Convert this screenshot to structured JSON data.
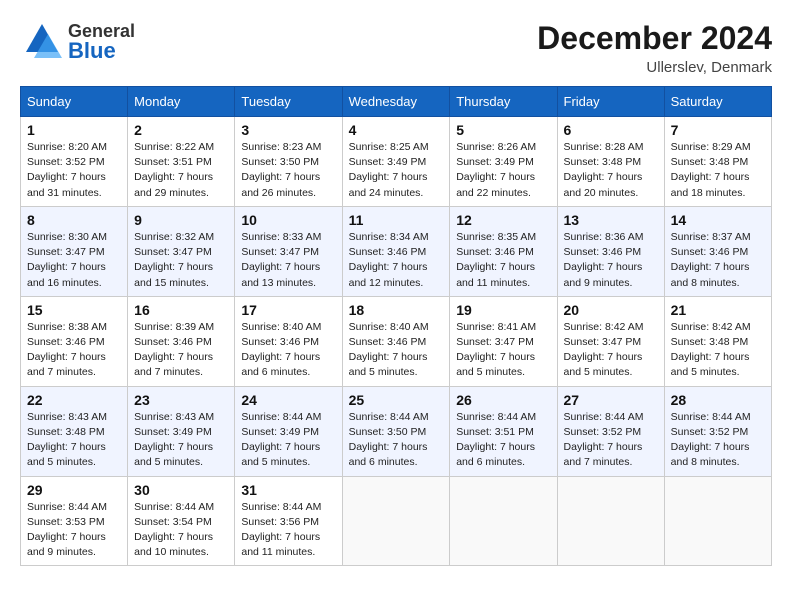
{
  "header": {
    "logo_general": "General",
    "logo_blue": "Blue",
    "month_title": "December 2024",
    "subtitle": "Ullerslev, Denmark"
  },
  "weekdays": [
    "Sunday",
    "Monday",
    "Tuesday",
    "Wednesday",
    "Thursday",
    "Friday",
    "Saturday"
  ],
  "weeks": [
    [
      {
        "day": "1",
        "sunrise": "Sunrise: 8:20 AM",
        "sunset": "Sunset: 3:52 PM",
        "daylight": "Daylight: 7 hours and 31 minutes."
      },
      {
        "day": "2",
        "sunrise": "Sunrise: 8:22 AM",
        "sunset": "Sunset: 3:51 PM",
        "daylight": "Daylight: 7 hours and 29 minutes."
      },
      {
        "day": "3",
        "sunrise": "Sunrise: 8:23 AM",
        "sunset": "Sunset: 3:50 PM",
        "daylight": "Daylight: 7 hours and 26 minutes."
      },
      {
        "day": "4",
        "sunrise": "Sunrise: 8:25 AM",
        "sunset": "Sunset: 3:49 PM",
        "daylight": "Daylight: 7 hours and 24 minutes."
      },
      {
        "day": "5",
        "sunrise": "Sunrise: 8:26 AM",
        "sunset": "Sunset: 3:49 PM",
        "daylight": "Daylight: 7 hours and 22 minutes."
      },
      {
        "day": "6",
        "sunrise": "Sunrise: 8:28 AM",
        "sunset": "Sunset: 3:48 PM",
        "daylight": "Daylight: 7 hours and 20 minutes."
      },
      {
        "day": "7",
        "sunrise": "Sunrise: 8:29 AM",
        "sunset": "Sunset: 3:48 PM",
        "daylight": "Daylight: 7 hours and 18 minutes."
      }
    ],
    [
      {
        "day": "8",
        "sunrise": "Sunrise: 8:30 AM",
        "sunset": "Sunset: 3:47 PM",
        "daylight": "Daylight: 7 hours and 16 minutes."
      },
      {
        "day": "9",
        "sunrise": "Sunrise: 8:32 AM",
        "sunset": "Sunset: 3:47 PM",
        "daylight": "Daylight: 7 hours and 15 minutes."
      },
      {
        "day": "10",
        "sunrise": "Sunrise: 8:33 AM",
        "sunset": "Sunset: 3:47 PM",
        "daylight": "Daylight: 7 hours and 13 minutes."
      },
      {
        "day": "11",
        "sunrise": "Sunrise: 8:34 AM",
        "sunset": "Sunset: 3:46 PM",
        "daylight": "Daylight: 7 hours and 12 minutes."
      },
      {
        "day": "12",
        "sunrise": "Sunrise: 8:35 AM",
        "sunset": "Sunset: 3:46 PM",
        "daylight": "Daylight: 7 hours and 11 minutes."
      },
      {
        "day": "13",
        "sunrise": "Sunrise: 8:36 AM",
        "sunset": "Sunset: 3:46 PM",
        "daylight": "Daylight: 7 hours and 9 minutes."
      },
      {
        "day": "14",
        "sunrise": "Sunrise: 8:37 AM",
        "sunset": "Sunset: 3:46 PM",
        "daylight": "Daylight: 7 hours and 8 minutes."
      }
    ],
    [
      {
        "day": "15",
        "sunrise": "Sunrise: 8:38 AM",
        "sunset": "Sunset: 3:46 PM",
        "daylight": "Daylight: 7 hours and 7 minutes."
      },
      {
        "day": "16",
        "sunrise": "Sunrise: 8:39 AM",
        "sunset": "Sunset: 3:46 PM",
        "daylight": "Daylight: 7 hours and 7 minutes."
      },
      {
        "day": "17",
        "sunrise": "Sunrise: 8:40 AM",
        "sunset": "Sunset: 3:46 PM",
        "daylight": "Daylight: 7 hours and 6 minutes."
      },
      {
        "day": "18",
        "sunrise": "Sunrise: 8:40 AM",
        "sunset": "Sunset: 3:46 PM",
        "daylight": "Daylight: 7 hours and 5 minutes."
      },
      {
        "day": "19",
        "sunrise": "Sunrise: 8:41 AM",
        "sunset": "Sunset: 3:47 PM",
        "daylight": "Daylight: 7 hours and 5 minutes."
      },
      {
        "day": "20",
        "sunrise": "Sunrise: 8:42 AM",
        "sunset": "Sunset: 3:47 PM",
        "daylight": "Daylight: 7 hours and 5 minutes."
      },
      {
        "day": "21",
        "sunrise": "Sunrise: 8:42 AM",
        "sunset": "Sunset: 3:48 PM",
        "daylight": "Daylight: 7 hours and 5 minutes."
      }
    ],
    [
      {
        "day": "22",
        "sunrise": "Sunrise: 8:43 AM",
        "sunset": "Sunset: 3:48 PM",
        "daylight": "Daylight: 7 hours and 5 minutes."
      },
      {
        "day": "23",
        "sunrise": "Sunrise: 8:43 AM",
        "sunset": "Sunset: 3:49 PM",
        "daylight": "Daylight: 7 hours and 5 minutes."
      },
      {
        "day": "24",
        "sunrise": "Sunrise: 8:44 AM",
        "sunset": "Sunset: 3:49 PM",
        "daylight": "Daylight: 7 hours and 5 minutes."
      },
      {
        "day": "25",
        "sunrise": "Sunrise: 8:44 AM",
        "sunset": "Sunset: 3:50 PM",
        "daylight": "Daylight: 7 hours and 6 minutes."
      },
      {
        "day": "26",
        "sunrise": "Sunrise: 8:44 AM",
        "sunset": "Sunset: 3:51 PM",
        "daylight": "Daylight: 7 hours and 6 minutes."
      },
      {
        "day": "27",
        "sunrise": "Sunrise: 8:44 AM",
        "sunset": "Sunset: 3:52 PM",
        "daylight": "Daylight: 7 hours and 7 minutes."
      },
      {
        "day": "28",
        "sunrise": "Sunrise: 8:44 AM",
        "sunset": "Sunset: 3:52 PM",
        "daylight": "Daylight: 7 hours and 8 minutes."
      }
    ],
    [
      {
        "day": "29",
        "sunrise": "Sunrise: 8:44 AM",
        "sunset": "Sunset: 3:53 PM",
        "daylight": "Daylight: 7 hours and 9 minutes."
      },
      {
        "day": "30",
        "sunrise": "Sunrise: 8:44 AM",
        "sunset": "Sunset: 3:54 PM",
        "daylight": "Daylight: 7 hours and 10 minutes."
      },
      {
        "day": "31",
        "sunrise": "Sunrise: 8:44 AM",
        "sunset": "Sunset: 3:56 PM",
        "daylight": "Daylight: 7 hours and 11 minutes."
      },
      null,
      null,
      null,
      null
    ]
  ]
}
